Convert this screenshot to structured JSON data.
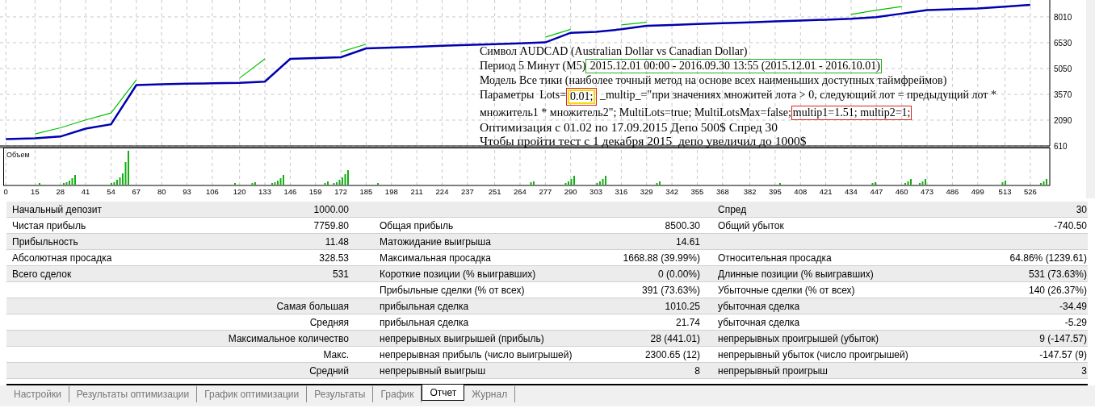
{
  "chart": {
    "chart_data": {
      "type": "line",
      "x": [
        0,
        15,
        28,
        41,
        54,
        67,
        80,
        93,
        106,
        120,
        133,
        146,
        159,
        172,
        185,
        198,
        211,
        224,
        237,
        251,
        264,
        277,
        290,
        303,
        316,
        329,
        342,
        355,
        368,
        382,
        395,
        408,
        421,
        434,
        447,
        460,
        473,
        486,
        499,
        513,
        526
      ],
      "xlim": [
        -3,
        536
      ],
      "ylim": [
        610,
        8980
      ],
      "grid": true,
      "yticks": [
        610,
        2090,
        3570,
        5050,
        6530,
        8010
      ],
      "xticks": [
        0,
        15,
        28,
        41,
        54,
        67,
        80,
        93,
        106,
        120,
        133,
        146,
        159,
        172,
        185,
        198,
        211,
        224,
        237,
        251,
        264,
        277,
        290,
        303,
        316,
        329,
        342,
        355,
        368,
        382,
        395,
        408,
        421,
        434,
        447,
        460,
        473,
        486,
        499,
        513,
        526
      ],
      "series": [
        {
          "color": "#00c000",
          "values": [
            null,
            1300,
            1650,
            2100,
            2500,
            4400,
            null,
            null,
            null,
            4500,
            5600,
            null,
            null,
            6000,
            6450,
            null,
            null,
            null,
            null,
            null,
            null,
            6850,
            7300,
            null,
            7550,
            7700,
            null,
            null,
            null,
            null,
            null,
            null,
            null,
            8150,
            8400,
            8600,
            null,
            null,
            null,
            null,
            null
          ]
        },
        {
          "color": "#0000b0",
          "values": [
            1000,
            1050,
            1150,
            1600,
            1850,
            4100,
            4150,
            4180,
            4200,
            4230,
            4300,
            5600,
            5650,
            5700,
            6200,
            6250,
            6300,
            6350,
            6400,
            6450,
            6500,
            6550,
            7100,
            7150,
            7300,
            7500,
            7550,
            7600,
            7650,
            7700,
            7750,
            7800,
            7850,
            7900,
            8000,
            8200,
            8400,
            8450,
            8500,
            8600,
            8700
          ]
        }
      ]
    },
    "volume_label": "Объем",
    "info_lines": [
      [
        {
          "text": "Символ AUDCAD (Australian Dollar vs Canadian Dollar)"
        }
      ],
      [
        {
          "text": "Период 5 Минут (M5)"
        },
        {
          "text": " 2015.12.01 00:00 - 2016.09.30 13:55 (2015.12.01 - 2016.10.01)",
          "color": "#20b020"
        }
      ],
      [
        {
          "text": "Модель Все тики (наиболее точный метод на основе всех наименьших доступных таймфреймов)"
        }
      ],
      [
        {
          "text": "Параметры  Lots="
        },
        {
          "text": "0.01;",
          "color": "#e02020",
          "inner_frame": {
            "color": "#f0e000"
          }
        },
        {
          "text": " _multip_=\"при значениях множитей лота > 0, следующий лот = предыдущий лот *"
        }
      ],
      [
        {
          "text": "множитель1 * множитель2\"; MultiLots=true; MultiLotsMax=false;"
        },
        {
          "text": "multip1=1.51; multip2=1;",
          "color": "#e02020"
        }
      ],
      [
        {
          "text": "Оптимизация с 01.02 по 17.09.2015 Депо 500$ Спред 30",
          "large": true
        }
      ],
      [
        {
          "text": "Чтобы пройти тест с 1 декабря 2015  депо увеличил до 1000$",
          "large": true
        }
      ]
    ]
  },
  "report": {
    "rows": [
      {
        "label_1": "Начальный депозит",
        "value_1": "1000.00",
        "label_3": "Спред",
        "value_3": "30"
      },
      {
        "label_1": "Чистая прибыль",
        "value_1": "7759.80",
        "label_2": "Общая прибыль",
        "value_2": "8500.30",
        "label_3": "Общий убыток",
        "value_3": "-740.50"
      },
      {
        "label_1": "Прибыльность",
        "value_1": "11.48",
        "label_2": "Матожидание выигрыша",
        "value_2": "14.61"
      },
      {
        "label_1": "Абсолютная просадка",
        "value_1": "328.53",
        "label_2": "Максимальная просадка",
        "value_2": "1668.88 (39.99%)",
        "label_3": "Относительная просадка",
        "value_3": "64.86% (1239.61)"
      },
      {
        "label_1": "Всего сделок",
        "value_1": "531",
        "label_2": "Короткие позиции (% выигравших)",
        "value_2": "0 (0.00%)",
        "label_3": "Длинные позиции (% выигравших)",
        "value_3": "531 (73.63%)"
      },
      {
        "label_2": "Прибыльные сделки (% от всех)",
        "value_2": "391 (73.63%)",
        "label_3": "Убыточные сделки (% от всех)",
        "value_3": "140 (26.37%)"
      },
      {
        "heading": "Самая большая",
        "label_2": "прибыльная сделка",
        "value_2": "1010.25",
        "label_3": "убыточная сделка",
        "value_3": "-34.49"
      },
      {
        "heading": "Средняя",
        "label_2": "прибыльная сделка",
        "value_2": "21.74",
        "label_3": "убыточная сделка",
        "value_3": "-5.29"
      },
      {
        "heading": "Максимальное количество",
        "label_2": "непрерывных выигрышей (прибыль)",
        "value_2": "28 (441.01)",
        "label_3": "непрерывных проигрышей (убыток)",
        "value_3": "9 (-147.57)"
      },
      {
        "heading": "Макс.",
        "label_2": "непрерывная прибыль (число выигрышей)",
        "value_2": "2300.65 (12)",
        "label_3": "непрерывный убыток (число проигрышей)",
        "value_3": "-147.57 (9)"
      },
      {
        "heading": "Средний",
        "label_2": "непрерывный выигрыш",
        "value_2": "8",
        "label_3": "непрерывный проигрыш",
        "value_3": "3"
      }
    ]
  },
  "tabs": [
    {
      "label": "Настройки",
      "selected": false
    },
    {
      "label": "Результаты оптимизации",
      "selected": false
    },
    {
      "label": "График оптимизации",
      "selected": false
    },
    {
      "label": "Результаты",
      "selected": false
    },
    {
      "label": "График",
      "selected": false
    },
    {
      "label": "Отчет",
      "selected": true
    },
    {
      "label": "Журнал",
      "selected": false
    }
  ]
}
